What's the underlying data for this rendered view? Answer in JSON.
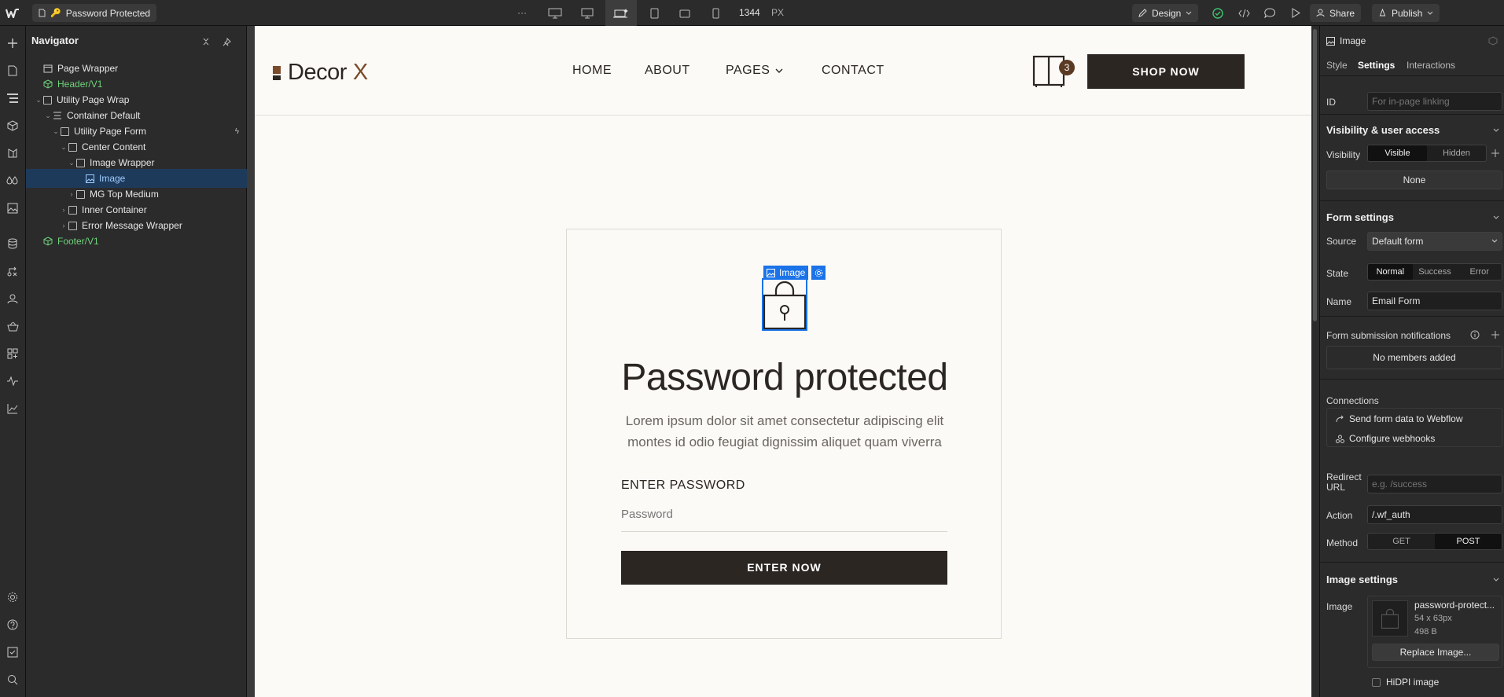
{
  "topbar": {
    "page_name": "Password Protected",
    "more": "···",
    "width_value": "1344",
    "width_unit": "PX",
    "design_label": "Design",
    "share_label": "Share",
    "publish_label": "Publish"
  },
  "navigator": {
    "title": "Navigator",
    "items": [
      {
        "label": "Page Wrapper"
      },
      {
        "label": "Header/V1"
      },
      {
        "label": "Utility Page Wrap"
      },
      {
        "label": "Container Default"
      },
      {
        "label": "Utility Page Form"
      },
      {
        "label": "Center Content"
      },
      {
        "label": "Image Wrapper"
      },
      {
        "label": "Image"
      },
      {
        "label": "MG Top Medium"
      },
      {
        "label": "Inner Container"
      },
      {
        "label": "Error Message Wrapper"
      },
      {
        "label": "Footer/V1"
      }
    ]
  },
  "site": {
    "logo_text": "Decor",
    "logo_x": "X",
    "nav": [
      "HOME",
      "ABOUT",
      "PAGES",
      "CONTACT"
    ],
    "cart_count": "3",
    "shop_button": "SHOP NOW",
    "selected_label": "Image",
    "heading": "Password protected",
    "description": "Lorem ipsum dolor sit amet consectetur adipiscing elit montes id odio feugiat dignissim aliquet quam viverra",
    "field_label": "ENTER PASSWORD",
    "field_placeholder": "Password",
    "submit": "ENTER NOW"
  },
  "right_panel": {
    "element_type": "Image",
    "tabs": [
      "Style",
      "Settings",
      "Interactions"
    ],
    "id_label": "ID",
    "id_placeholder": "For in-page linking",
    "visibility_section": "Visibility & user access",
    "visibility_label": "Visibility",
    "visibility_options": [
      "Visible",
      "Hidden"
    ],
    "none_label": "None",
    "form_section": "Form settings",
    "source_label": "Source",
    "source_value": "Default form",
    "state_label": "State",
    "state_options": [
      "Normal",
      "Success",
      "Error"
    ],
    "name_label": "Name",
    "name_value": "Email Form",
    "notifications_label": "Form submission notifications",
    "no_members": "No members added",
    "connections_label": "Connections",
    "send_form": "Send form data to Webflow",
    "webhooks": "Configure webhooks",
    "redirect_label": "Redirect URL",
    "redirect_placeholder": "e.g. /success",
    "action_label": "Action",
    "action_value": "/.wf_auth",
    "method_label": "Method",
    "method_options": [
      "GET",
      "POST"
    ],
    "image_section": "Image settings",
    "image_label": "Image",
    "file_name": "password-protect...",
    "file_dims": "54 x 63px",
    "file_size": "498 B",
    "replace_button": "Replace Image...",
    "hidpi_label": "HiDPI image"
  },
  "colors": {
    "accent": "#1a73e8",
    "brand_dark": "#2b2622",
    "brand_brown": "#7a4a2a",
    "canvas_bg": "#fbfaf6",
    "component_green": "#6fd37a"
  }
}
